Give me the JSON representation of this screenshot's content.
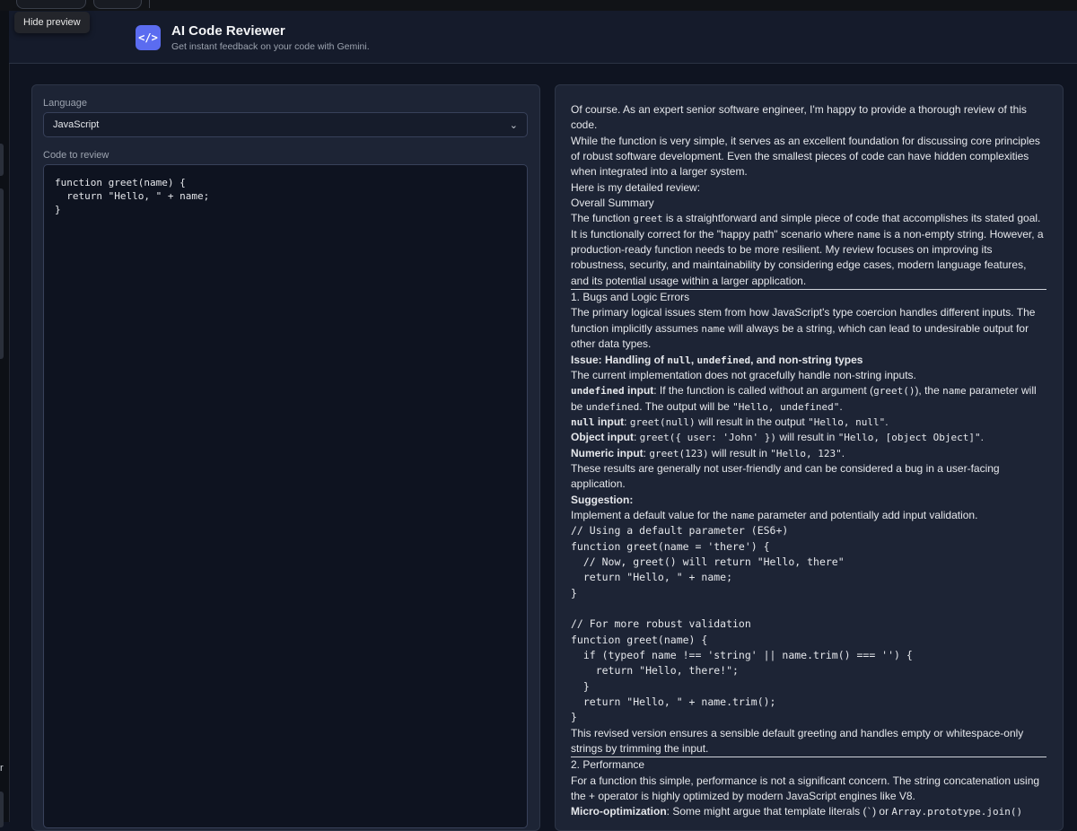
{
  "tooltip": "Hide preview",
  "rail_letter": "r",
  "header": {
    "logo_glyph": "</>",
    "title": "AI Code Reviewer",
    "subtitle": "Get instant feedback on your code with Gemini."
  },
  "form": {
    "language_label": "Language",
    "language_value": "JavaScript",
    "code_label": "Code to review",
    "code_value": "function greet(name) {\n  return \"Hello, \" + name;\n}"
  },
  "review": {
    "intro1": "Of course. As an expert senior software engineer, I'm happy to provide a thorough review of this code.",
    "intro2": "While the function is very simple, it serves as an excellent foundation for discussing core principles of robust software development. Even the smallest pieces of code can have hidden complexities when integrated into a larger system.",
    "intro3": "Here is my detailed review:",
    "overall_heading": "Overall Summary",
    "overall_t1": "The function ",
    "overall_c1": "greet",
    "overall_t2": " is a straightforward and simple piece of code that accomplishes its stated goal. It is functionally correct for the \"happy path\" scenario where ",
    "overall_c2": "name",
    "overall_t3": " is a non-empty string. However, a production-ready function needs to be more resilient. My review focuses on improving its robustness, security, and maintainability by considering edge cases, modern language features, and its potential usage within a larger application.",
    "bugs_heading": "1. Bugs and Logic Errors",
    "bugs_t1": "The primary logical issues stem from how JavaScript's type coercion handles different inputs. The function implicitly assumes ",
    "bugs_c1": "name",
    "bugs_t2": " will always be a string, which can lead to undesirable output for other data types.",
    "issue_t1": "Issue: Handling of ",
    "issue_c1": "null",
    "issue_t2": ", ",
    "issue_c2": "undefined",
    "issue_t3": ", and non-string types",
    "current_impl": "The current implementation does not gracefully handle non-string inputs.",
    "undef_label": "undefined",
    "undef_t1": " input",
    "undef_t2": ": If the function is called without an argument (",
    "undef_c1": "greet()",
    "undef_t3": "), the ",
    "undef_c2": "name",
    "undef_t4": " parameter will be ",
    "undef_c3": "undefined",
    "undef_t5": ". The output will be ",
    "undef_c4": "\"Hello, undefined\"",
    "undef_t6": ".",
    "null_label": "null",
    "null_t1": " input",
    "null_t2": ": ",
    "null_c1": "greet(null)",
    "null_t3": " will result in the output ",
    "null_c2": "\"Hello, null\"",
    "null_t4": ".",
    "obj_label": "Object input",
    "obj_t1": ": ",
    "obj_c1": "greet({ user: 'John' })",
    "obj_t2": " will result in ",
    "obj_c2": "\"Hello, [object Object]\"",
    "obj_t3": ".",
    "num_label": "Numeric input",
    "num_t1": ": ",
    "num_c1": "greet(123)",
    "num_t2": " will result in ",
    "num_c2": "\"Hello, 123\"",
    "num_t3": ".",
    "results_text": "These results are generally not user-friendly and can be considered a bug in a user-facing application.",
    "suggestion_label": "Suggestion:",
    "impl_t1": "Implement a default value for the ",
    "impl_c1": "name",
    "impl_t2": " parameter and potentially add input validation.",
    "code_sample": "// Using a default parameter (ES6+)\nfunction greet(name = 'there') {\n  // Now, greet() will return \"Hello, there\"\n  return \"Hello, \" + name;\n}\n\n// For more robust validation\nfunction greet(name) {\n  if (typeof name !== 'string' || name.trim() === '') {\n    return \"Hello, there!\";\n  }\n  return \"Hello, \" + name.trim();\n}",
    "revised_text": "This revised version ensures a sensible default greeting and handles empty or whitespace-only strings by trimming the input.",
    "perf_heading": "2. Performance",
    "perf_text": "For a function this simple, performance is not a significant concern. The string concatenation using the + operator is highly optimized by modern JavaScript engines like V8.",
    "micro_label": "Micro-optimization",
    "micro_t1": ": Some might argue that template literals (",
    "micro_t2": "`",
    "micro_t3": ") or ",
    "micro_c1": "Array.prototype.join()"
  },
  "colors": {
    "accent": "#5b6cf0",
    "background": "#0f1421",
    "panel": "#1d2435"
  }
}
